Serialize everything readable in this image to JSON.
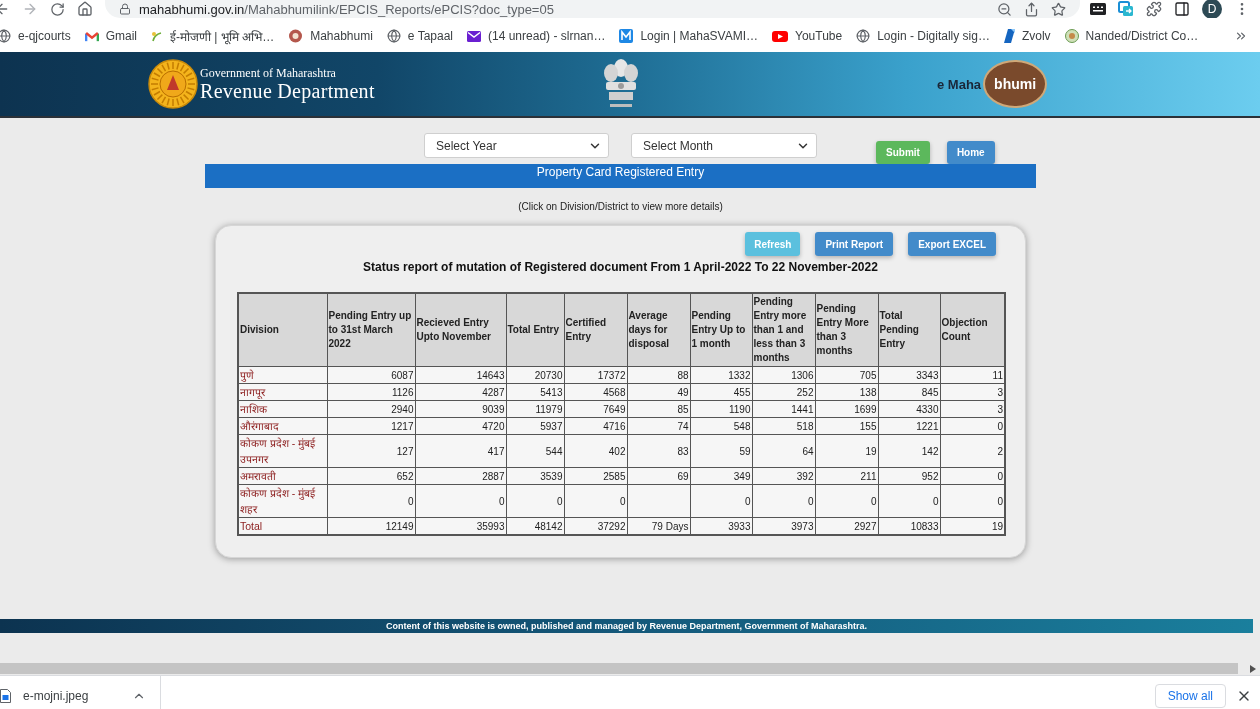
{
  "browser": {
    "url": {
      "host": "mahabhumi.gov.in",
      "path": "/Mahabhumilink/EPCIS_Reports/ePCIS?doc_type=05"
    },
    "profile_initial": "D",
    "bookmarks": [
      {
        "label": "e-qjcourts",
        "kind": "globe"
      },
      {
        "label": "Gmail",
        "kind": "gmail"
      },
      {
        "label": "ई-मोजणी | भूमि अभि…",
        "kind": "sprout"
      },
      {
        "label": "Mahabhumi",
        "kind": "emblem"
      },
      {
        "label": "e Tapaal",
        "kind": "globe"
      },
      {
        "label": "(14 unread) - slrnan…",
        "kind": "mail"
      },
      {
        "label": "Login | MahaSVAMI…",
        "kind": "letter"
      },
      {
        "label": "YouTube",
        "kind": "play"
      },
      {
        "label": "Login - Digitally sig…",
        "kind": "globe"
      },
      {
        "label": "Zvolv",
        "kind": "zvolv"
      },
      {
        "label": "Nanded/District Co…",
        "kind": "seal"
      }
    ]
  },
  "header": {
    "line_1": "Government of Maharashtra",
    "line_2": "Revenue Department",
    "logo": {
      "prefix": "e Maha",
      "badge": "bhumi"
    }
  },
  "filters": [
    {
      "value": "Select Year"
    },
    {
      "value": "Select Month"
    }
  ],
  "buttons": [
    {
      "label": "Submit",
      "kind": "success"
    },
    {
      "label": "Home",
      "kind": "primary"
    }
  ],
  "banner": "Property Card Registered Entry",
  "hint": "(Click on Division/District to view more details)",
  "report": {
    "actions": [
      {
        "label": "Refresh",
        "kind": "info"
      },
      {
        "label": "Print Report",
        "kind": "primary"
      },
      {
        "label": "Export EXCEL",
        "kind": "primary"
      }
    ],
    "title": "Status report of mutation of Registered document From 1 April-2022 To 22 November-2022",
    "columns": [
      "Division",
      "Pending Entry up to 31st March 2022",
      "Recieved Entry Upto November",
      "Total Entry",
      "Certified Entry",
      "Average days for disposal",
      "Pending Entry Up to 1 month",
      "Pending Entry more than 1 and less than 3 months",
      "Pending Entry More than 3 months",
      "Total Pending Entry",
      "Objection Count"
    ],
    "rows": [
      {
        "division": "पुणे",
        "pending_to_march": "6087",
        "received": "14643",
        "total_entry": "20730",
        "certified": "17372",
        "avg_days": "88",
        "pending_1_month": "1332",
        "pending_1_to_3_months": "1306",
        "pending_over_3_months": "705",
        "total_pending": "3343",
        "objection_count": "11"
      },
      {
        "division": "नागपूर",
        "pending_to_march": "1126",
        "received": "4287",
        "total_entry": "5413",
        "certified": "4568",
        "avg_days": "49",
        "pending_1_month": "455",
        "pending_1_to_3_months": "252",
        "pending_over_3_months": "138",
        "total_pending": "845",
        "objection_count": "3"
      },
      {
        "division": "नाशिक",
        "pending_to_march": "2940",
        "received": "9039",
        "total_entry": "11979",
        "certified": "7649",
        "avg_days": "85",
        "pending_1_month": "1190",
        "pending_1_to_3_months": "1441",
        "pending_over_3_months": "1699",
        "total_pending": "4330",
        "objection_count": "3"
      },
      {
        "division": "औरंगाबाद",
        "pending_to_march": "1217",
        "received": "4720",
        "total_entry": "5937",
        "certified": "4716",
        "avg_days": "74",
        "pending_1_month": "548",
        "pending_1_to_3_months": "518",
        "pending_over_3_months": "155",
        "total_pending": "1221",
        "objection_count": "0"
      },
      {
        "division": "कोकण प्रदेश - मुंबई उपनगर",
        "pending_to_march": "127",
        "received": "417",
        "total_entry": "544",
        "certified": "402",
        "avg_days": "83",
        "pending_1_month": "59",
        "pending_1_to_3_months": "64",
        "pending_over_3_months": "19",
        "total_pending": "142",
        "objection_count": "2"
      },
      {
        "division": "अमरावती",
        "pending_to_march": "652",
        "received": "2887",
        "total_entry": "3539",
        "certified": "2585",
        "avg_days": "69",
        "pending_1_month": "349",
        "pending_1_to_3_months": "392",
        "pending_over_3_months": "211",
        "total_pending": "952",
        "objection_count": "0"
      },
      {
        "division": "कोकण प्रदेश - मुंबई शहर",
        "pending_to_march": "0",
        "received": "0",
        "total_entry": "0",
        "certified": "0",
        "pending_1_month": "0",
        "pending_1_to_3_months": "0",
        "pending_over_3_months": "0",
        "total_pending": "0",
        "objection_count": "0"
      },
      {
        "division": "Total",
        "pending_to_march": "12149",
        "received": "35993",
        "total_entry": "48142",
        "certified": "37292",
        "avg_days": "79 Days",
        "pending_1_month": "3933",
        "pending_1_to_3_months": "3973",
        "pending_over_3_months": "2927",
        "total_pending": "10833",
        "objection_count": "19"
      }
    ]
  },
  "footer": "Content of this website is owned, published and managed by Revenue Department, Government of Maharashtra.",
  "downloads": {
    "file": "e-mojni.jpeg",
    "show_all": "Show all"
  }
}
